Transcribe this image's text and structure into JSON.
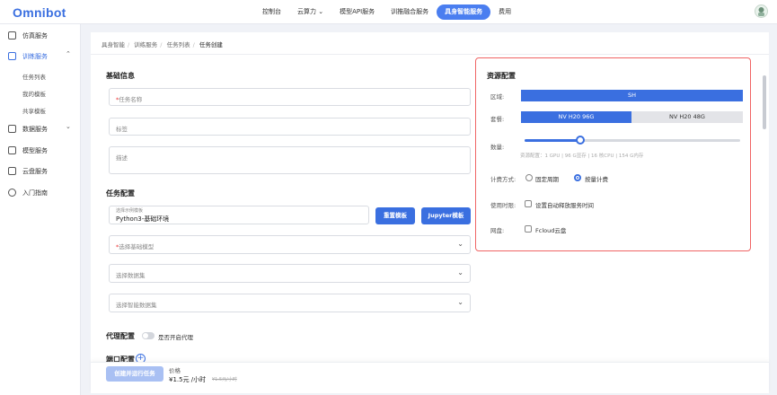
{
  "app": {
    "logo": "Omnibot"
  },
  "nav": {
    "items": [
      "控制台",
      "云算力 ⌄",
      "模型API服务",
      "训推融合服务",
      "具身智能服务",
      "费用"
    ],
    "active_index": 4
  },
  "sidebar": {
    "items": [
      {
        "label": "仿真服务",
        "icon": "document-icon"
      },
      {
        "label": "训练服务",
        "icon": "shield-icon",
        "chevron": "⌃"
      },
      {
        "label": "数据服务",
        "icon": "database-icon",
        "chevron": "⌄"
      },
      {
        "label": "模型服务",
        "icon": "server-icon"
      },
      {
        "label": "云盘服务",
        "icon": "disk-icon"
      },
      {
        "label": "入门指南",
        "icon": "gear-icon"
      }
    ],
    "sub_items": [
      "任务列表",
      "我的模板",
      "共享模板"
    ]
  },
  "breadcrumb": [
    "具身智能",
    "训练服务",
    "任务列表",
    "任务创建"
  ],
  "basic_info": {
    "title": "基础信息",
    "task_name_placeholder": "任务名称",
    "tags_placeholder": "标签",
    "desc_placeholder": "描述"
  },
  "task_config": {
    "title": "任务配置",
    "template_float_label": "选择示例模板",
    "template_value": "Python3-基础环境",
    "reset_button": "重置模板",
    "jupyter_button": "Jupyter模板",
    "base_model_placeholder": "选择基础模型",
    "dataset_placeholder": "选择数据集",
    "smart_dataset_placeholder": "选择智能数据集"
  },
  "proxy": {
    "title": "代理配置",
    "toggle_label": "是否开启代理"
  },
  "port": {
    "title": "端口配置"
  },
  "resource": {
    "title": "资源配置",
    "region_label": "区域:",
    "region_value": "SH",
    "package_label": "套餐:",
    "packages": [
      "NV H20 96G",
      "NV H20 48G"
    ],
    "package_selected": 0,
    "quantity_label": "数量:",
    "quantity_fraction": 0.26,
    "spec_text": "资源配置：1 GPU | 96 G显存 | 16 核CPU | 154 G内存",
    "billing_label": "计费方式:",
    "billing_options": [
      "固定周期",
      "按量计费"
    ],
    "billing_selected": 1,
    "duration_label": "使用时限:",
    "duration_option": "设置自动释放服务时间",
    "disk_label": "网盘:",
    "disk_option": "Fcloud云盘"
  },
  "footer": {
    "create_button": "创建并运行任务",
    "price_label": "价格",
    "price_value": "¥1.5元 /小时",
    "price_original": "¥1.5元/小时"
  },
  "colors": {
    "accent": "#3a6fe0",
    "panel_border": "#f06464"
  }
}
